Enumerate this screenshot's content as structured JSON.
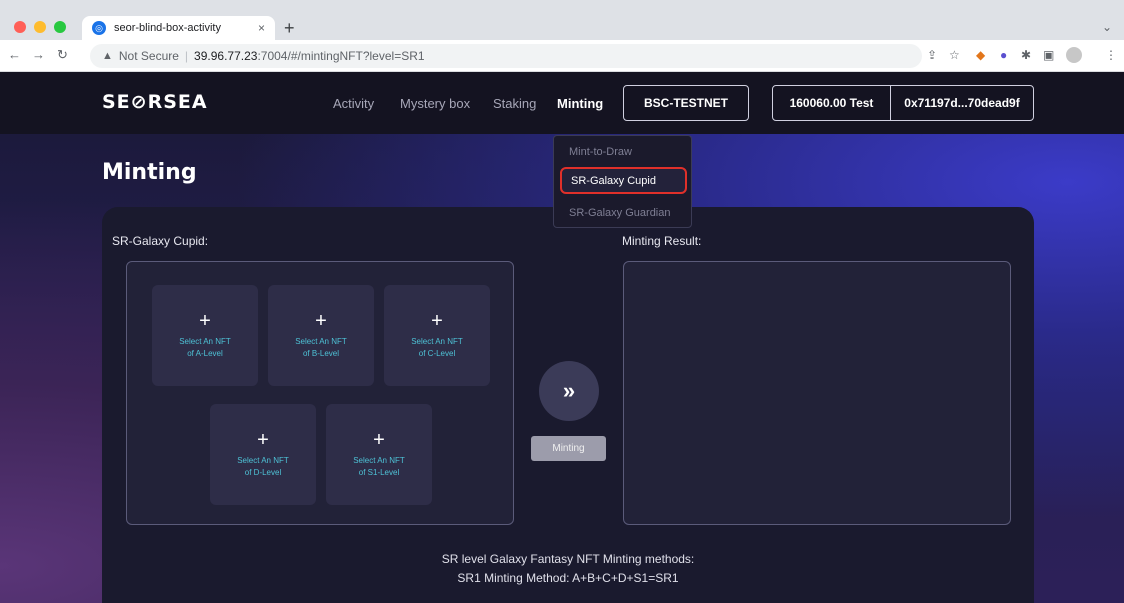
{
  "browser": {
    "tab_title": "seor-blind-box-activity",
    "tab_close": "×",
    "new_tab": "+",
    "tab_menu": "⌄",
    "security_label": "Not Secure",
    "url_host": "39.96.77.23",
    "url_rest": ":7004/#/mintingNFT?level=SR1",
    "colors": {
      "close": "#ff5f57",
      "minimize": "#febc2e",
      "maximize": "#28c840"
    }
  },
  "header": {
    "logo": "SE⊘RSEA",
    "nav": [
      "Activity",
      "Mystery box",
      "Staking",
      "Minting"
    ],
    "network": "BSC-TESTNET",
    "balance": "160060.00 Test",
    "address": "0x71197d...70dead9f"
  },
  "dropdown": {
    "items": [
      "Mint-to-Draw",
      "SR-Galaxy Cupid",
      "SR-Galaxy Guardian"
    ]
  },
  "page": {
    "title": "Minting",
    "left_label": "SR-Galaxy Cupid:",
    "right_label": "Minting Result:",
    "slots": [
      {
        "plus": "+",
        "line1": "Select An NFT",
        "line2": "of A-Level"
      },
      {
        "plus": "+",
        "line1": "Select An NFT",
        "line2": "of B-Level"
      },
      {
        "plus": "+",
        "line1": "Select An NFT",
        "line2": "of C-Level"
      },
      {
        "plus": "+",
        "line1": "Select An NFT",
        "line2": "of D-Level"
      },
      {
        "plus": "+",
        "line1": "Select An NFT",
        "line2": "of S1-Level"
      }
    ],
    "arrow": "»",
    "mint_button": "Minting",
    "methods_title": "SR level Galaxy Fantasy NFT Minting methods:",
    "methods_line": "SR1 Minting Method: A+B+C+D+S1=SR1"
  }
}
